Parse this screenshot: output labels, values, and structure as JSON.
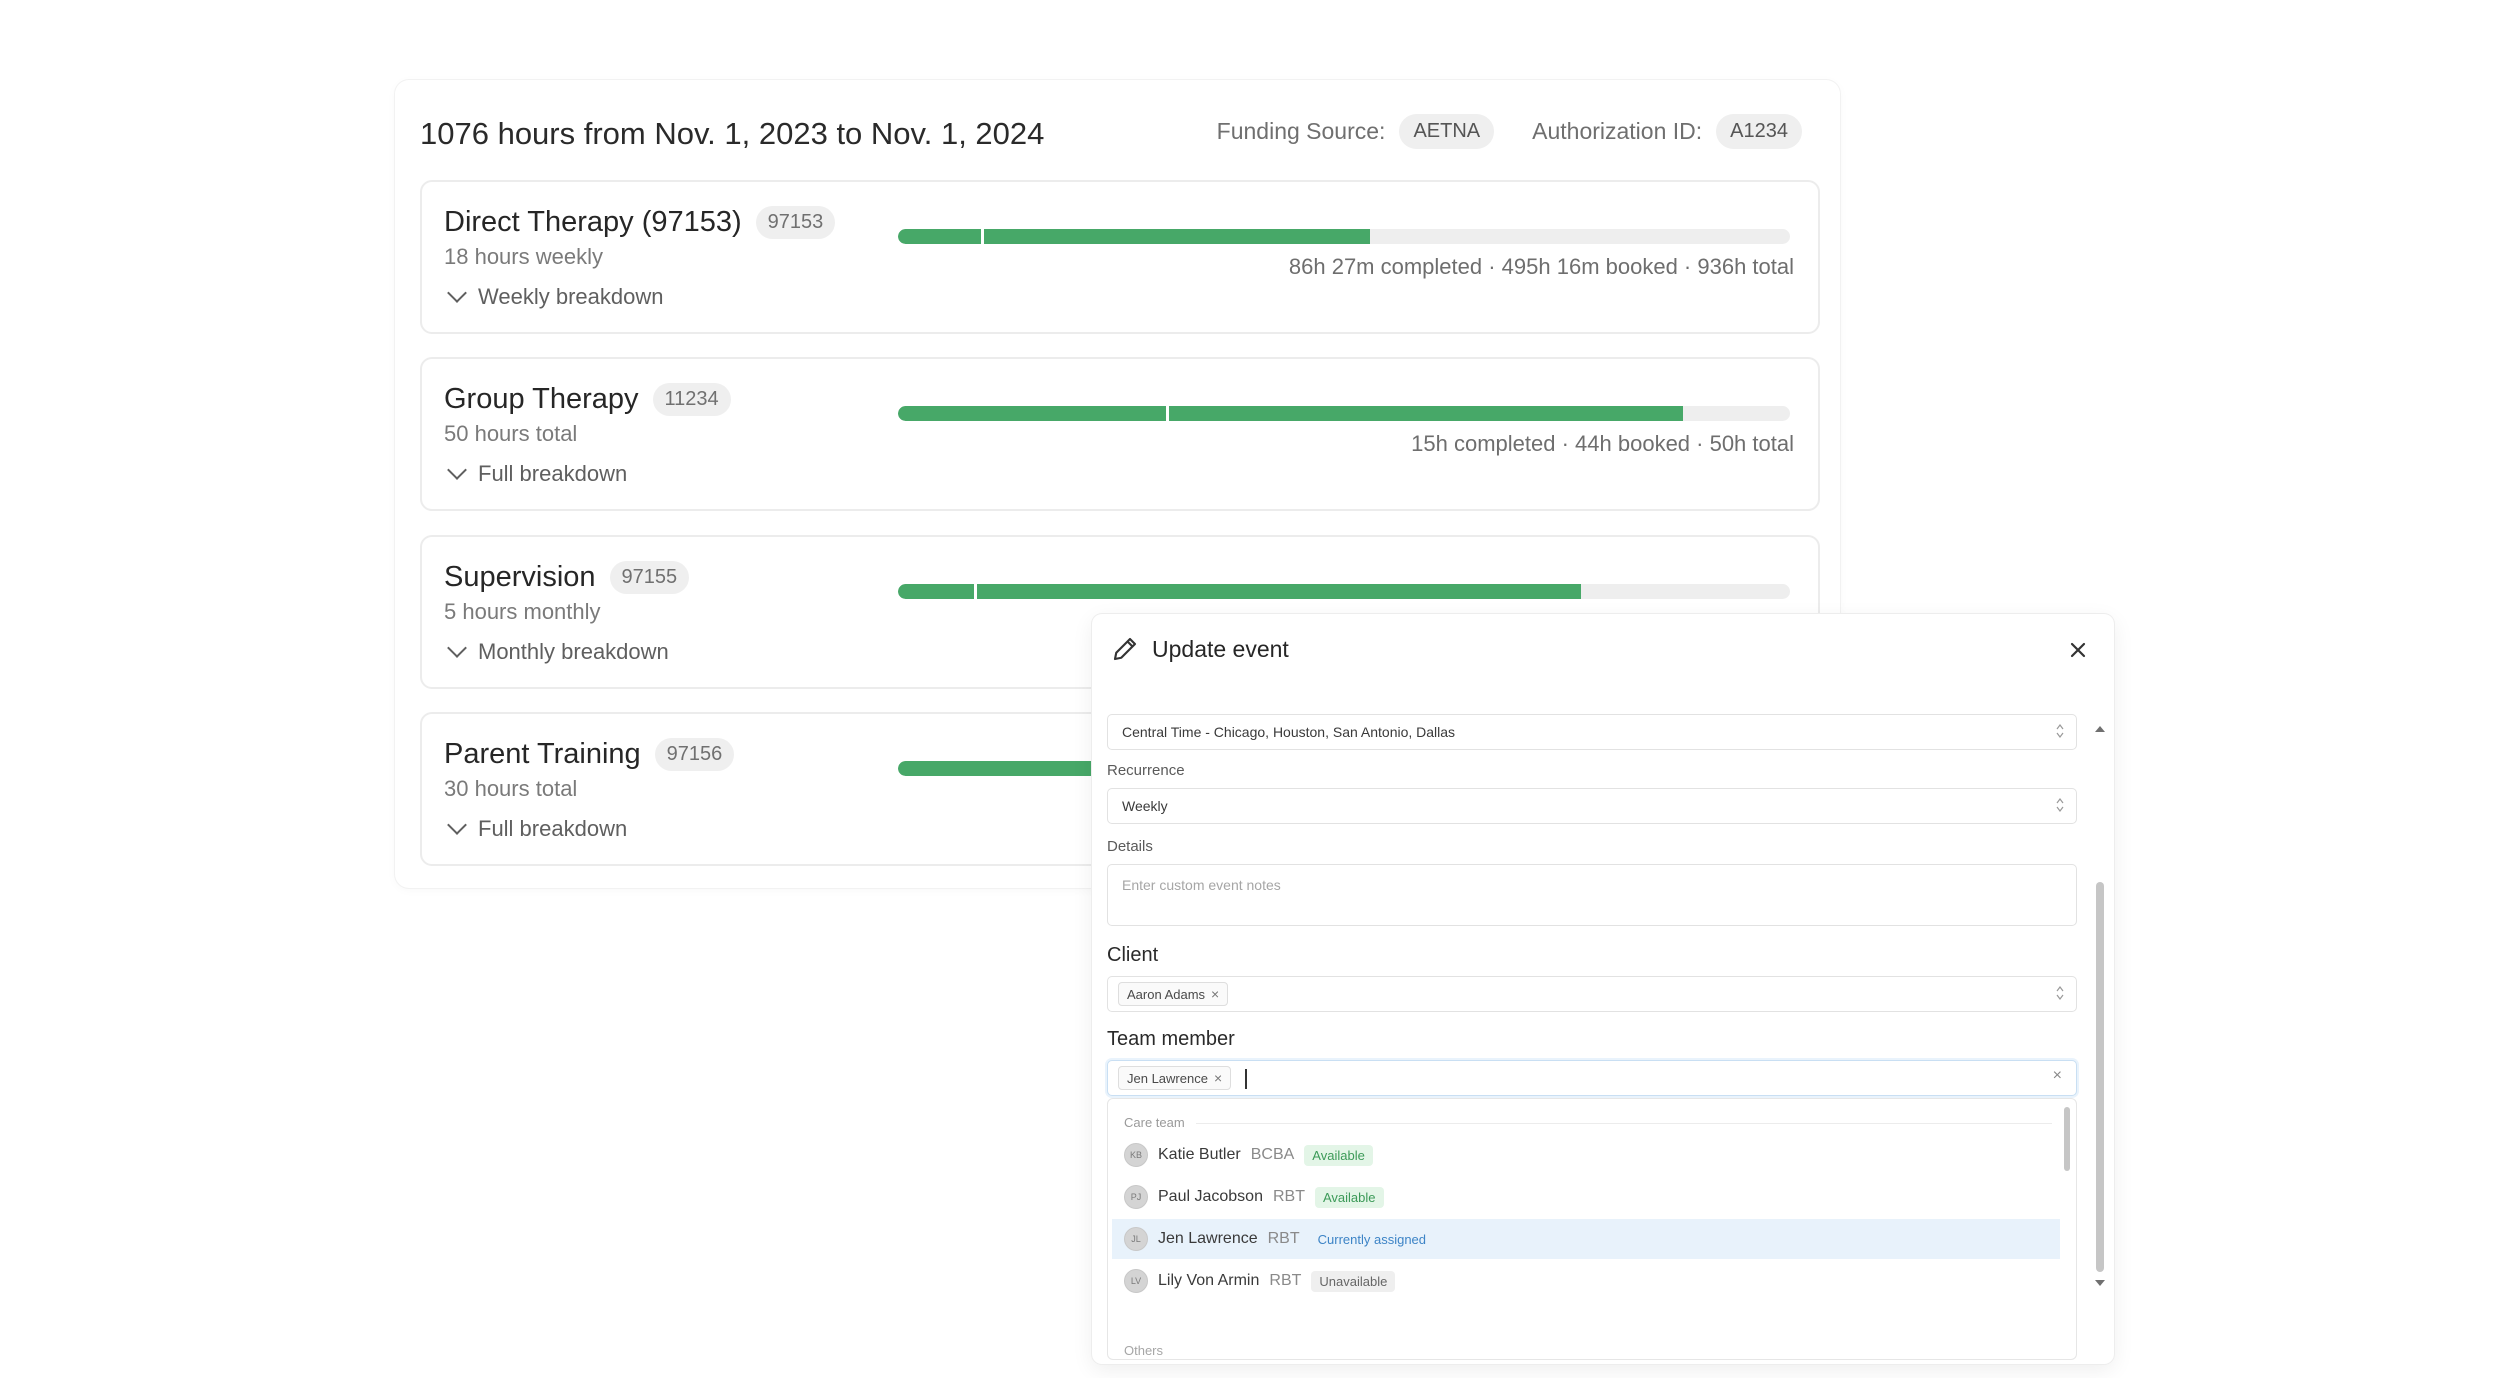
{
  "authorization": {
    "title": "1076 hours from Nov. 1, 2023 to Nov. 1, 2024",
    "funding_source_label": "Funding Source:",
    "funding_source_value": "AETNA",
    "authorization_id_label": "Authorization ID:",
    "authorization_id_value": "A1234"
  },
  "services": [
    {
      "name": "Direct Therapy (97153)",
      "code": "97153",
      "frequency": "18 hours weekly",
      "breakdown_label": "Weekly breakdown",
      "completed_fraction": 0.093,
      "booked_fraction": 0.529,
      "stats": "86h 27m completed · 495h 16m booked · 936h total"
    },
    {
      "name": "Group Therapy",
      "code": "11234",
      "frequency": "50 hours total",
      "breakdown_label": "Full breakdown",
      "completed_fraction": 0.3,
      "booked_fraction": 0.88,
      "stats": "15h completed · 44h booked · 50h total"
    },
    {
      "name": "Supervision",
      "code": "97155",
      "frequency": "5 hours monthly",
      "breakdown_label": "Monthly breakdown",
      "completed_fraction": 0.085,
      "booked_fraction": 0.766,
      "stats": ""
    },
    {
      "name": "Parent Training",
      "code": "97156",
      "frequency": "30 hours total",
      "breakdown_label": "Full breakdown",
      "completed_fraction": 0.0,
      "booked_fraction": 0.25,
      "stats": ""
    }
  ],
  "modal": {
    "title": "Update event",
    "timezone_value": "Central Time - Chicago, Houston, San Antonio, Dallas",
    "recurrence_label": "Recurrence",
    "recurrence_value": "Weekly",
    "details_label": "Details",
    "details_placeholder": "Enter custom event notes",
    "client_label": "Client",
    "client_chip": "Aaron Adams",
    "team_member_label": "Team member",
    "team_member_chip": "Jen Lawrence",
    "dropdown": {
      "group_label": "Care team",
      "next_group_label": "Others",
      "options": [
        {
          "initials": "KB",
          "name": "Katie Butler",
          "role": "BCBA",
          "status": "Available",
          "status_type": "available"
        },
        {
          "initials": "PJ",
          "name": "Paul Jacobson",
          "role": "RBT",
          "status": "Available",
          "status_type": "available"
        },
        {
          "initials": "JL",
          "name": "Jen Lawrence",
          "role": "RBT",
          "status": "Currently assigned",
          "status_type": "assigned"
        },
        {
          "initials": "LV",
          "name": "Lily Von Armin",
          "role": "RBT",
          "status": "Unavailable",
          "status_type": "unavailable"
        }
      ]
    }
  },
  "colors": {
    "progress_green": "#47a868",
    "track_gray": "#eeeeee",
    "selected_row": "#e8f2fb",
    "assigned_blue": "#3d84c6",
    "primary_button": "#3a8fd6"
  },
  "icons": {
    "edit": "pencil-icon",
    "close": "close-icon",
    "expand": "chevron-down-icon",
    "select": "updown-icon"
  }
}
